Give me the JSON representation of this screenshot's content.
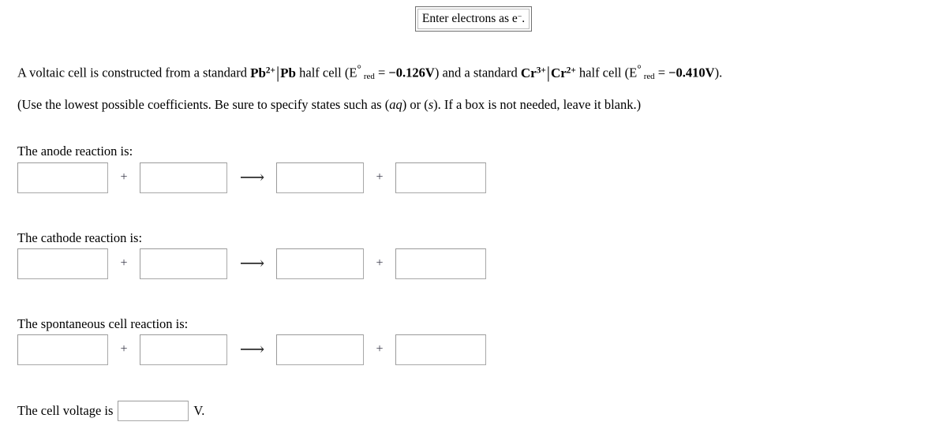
{
  "hint": {
    "text_before": "Enter electrons as e",
    "superscript": "−",
    "text_after": "."
  },
  "problem": {
    "line1_part1": "A voltaic cell is constructed from a standard ",
    "half_cell_1": {
      "ion": "Pb",
      "ion_charge": "2+",
      "metal": "Pb"
    },
    "line1_part2": " half cell (E",
    "degree": "°",
    "sub_red": "red",
    "equals": " = ",
    "potential_1": "−0.126V",
    "line1_part3": ") and a standard ",
    "half_cell_2": {
      "ion": "Cr",
      "ion_charge": "3+",
      "metal": "Cr",
      "metal_charge": "2+"
    },
    "line1_part4": " half cell (E",
    "potential_2": "−0.410V",
    "line1_part5": ").",
    "line2_part1": "(Use the lowest possible coefficients. Be sure to specify states such as (",
    "state_aq": "aq",
    "line2_part2": ") or (",
    "state_s": "s",
    "line2_part3": "). If a box is not needed, leave it blank.)"
  },
  "reactions": [
    {
      "label": "The anode reaction is:",
      "boxes": [
        "",
        "",
        "",
        ""
      ],
      "plus_symbol": "+",
      "arrow_symbol": "⟶"
    },
    {
      "label": "The cathode reaction is:",
      "boxes": [
        "",
        "",
        "",
        ""
      ],
      "plus_symbol": "+",
      "arrow_symbol": "⟶"
    },
    {
      "label": "The spontaneous cell reaction is:",
      "boxes": [
        "",
        "",
        "",
        ""
      ],
      "plus_symbol": "+",
      "arrow_symbol": "⟶"
    }
  ],
  "voltage": {
    "label_prefix": "The cell voltage is",
    "value": "",
    "unit": "V."
  }
}
